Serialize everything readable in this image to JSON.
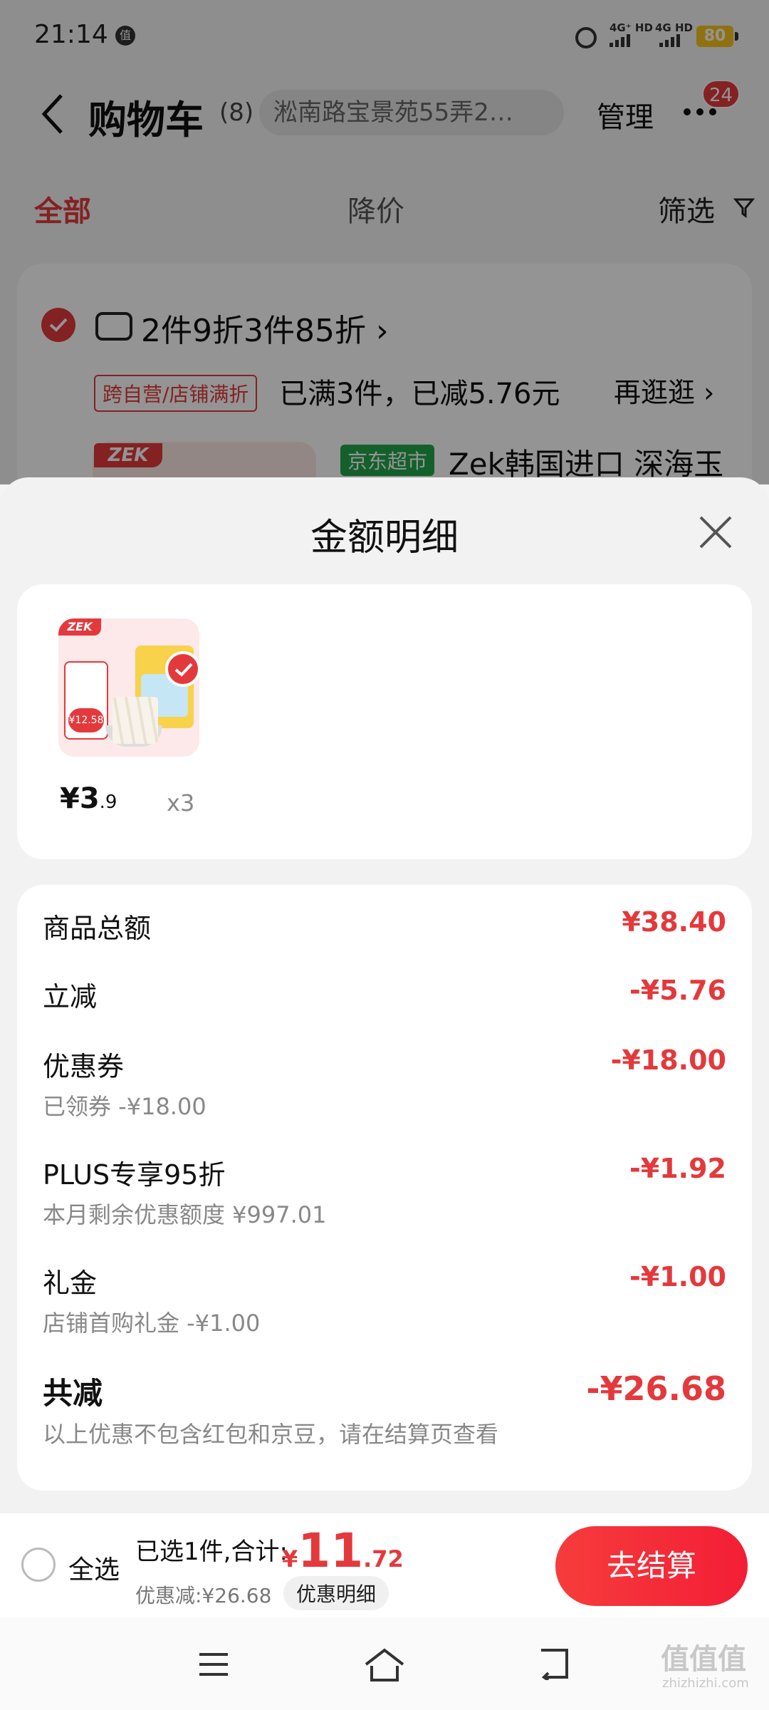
{
  "status": {
    "time": "21:14",
    "app_icon": "值",
    "net1": "4G⁺ HD",
    "net2": "4G HD",
    "battery": "80"
  },
  "nav": {
    "title": "购物车",
    "count": "(8)",
    "address": "淞南路宝景苑55弄2…",
    "manage": "管理",
    "badge": "24"
  },
  "tabs": {
    "all": "全部",
    "price_drop": "降价",
    "filter": "筛选"
  },
  "cart": {
    "promo_title": "2件9折3件85折 ›",
    "promo_tag": "跨自营/店铺满折",
    "promo_desc": "已满3件，已减5.76元",
    "promo_more": "再逛逛 ›",
    "jd_tag": "京东超市",
    "product_name": "Zek韩国进口 深海玉",
    "zek_logo": "ZEK"
  },
  "sheet": {
    "title": "金额明细",
    "product": {
      "price_int": "¥3",
      "price_dec": ".9",
      "qty": "x3",
      "logo": "ZEK",
      "sticker_price": "¥12.58"
    },
    "rows": {
      "goods_total": {
        "label": "商品总额",
        "value": "¥38.40"
      },
      "instant_discount": {
        "label": "立减",
        "value": "-¥5.76"
      },
      "coupon": {
        "label": "优惠券",
        "sub": "已领券 -¥18.00",
        "value": "-¥18.00"
      },
      "plus": {
        "label": "PLUS专享95折",
        "sub": "本月剩余优惠额度 ¥997.01",
        "value": "-¥1.92"
      },
      "gift": {
        "label": "礼金",
        "sub": "店铺首购礼金 -¥1.00",
        "value": "-¥1.00"
      },
      "total_off": {
        "label": "共减",
        "sub": "以上优惠不包含红包和京豆，请在结算页查看",
        "value": "-¥26.68"
      }
    }
  },
  "bottom": {
    "select_all": "全选",
    "selected_text": "已选1件,合计:",
    "yen": "¥",
    "total_int": "11",
    "total_dec": ".72",
    "discount_text": "优惠减:¥26.68",
    "detail_button": "优惠明细",
    "checkout": "去结算"
  },
  "watermark": {
    "text": "值值值",
    "url": "zhizhizhi.com"
  },
  "colors": {
    "accent": "#e4393c",
    "jd_green": "#21a64a"
  }
}
